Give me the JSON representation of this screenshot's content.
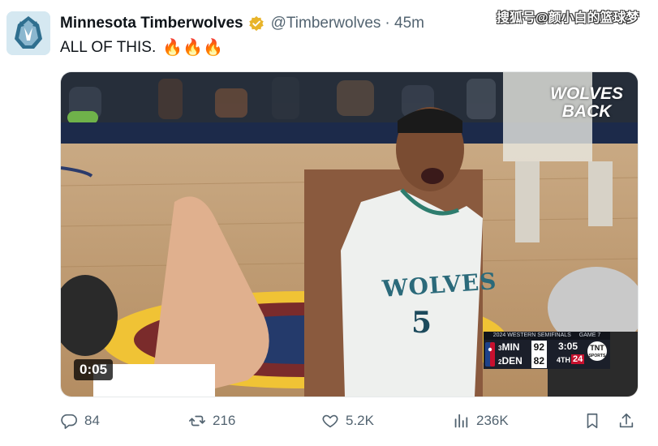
{
  "tweet": {
    "author_name": "Minnesota Timberwolves",
    "author_handle": "@Timberwolves",
    "time": "· 45m",
    "text": "ALL OF THIS.",
    "emoji": "🔥🔥🔥"
  },
  "watermark": "搜狐号@颜小白的篮球梦",
  "media": {
    "duration": "0:05",
    "brand_line1": "WOLVES",
    "brand_line2": "BACK",
    "jersey_text": "WOLVES",
    "jersey_number": "5",
    "scorebug": {
      "header": "2024 WESTERN SEMIFINALS",
      "game": "GAME 7",
      "team1": {
        "seed": "3",
        "abbr": "MIN",
        "score": "92"
      },
      "team2": {
        "seed": "2",
        "abbr": "DEN",
        "score": "82"
      },
      "clock": "3:05",
      "quarter": "4TH",
      "shot_clock": "24",
      "network": "TNT",
      "network_sub": "SPORTS"
    }
  },
  "actions": {
    "replies": "84",
    "retweets": "216",
    "likes": "5.2K",
    "views": "236K"
  },
  "colors": {
    "text_primary": "#0f1419",
    "text_secondary": "#536471",
    "verified": "#e8b42a"
  }
}
